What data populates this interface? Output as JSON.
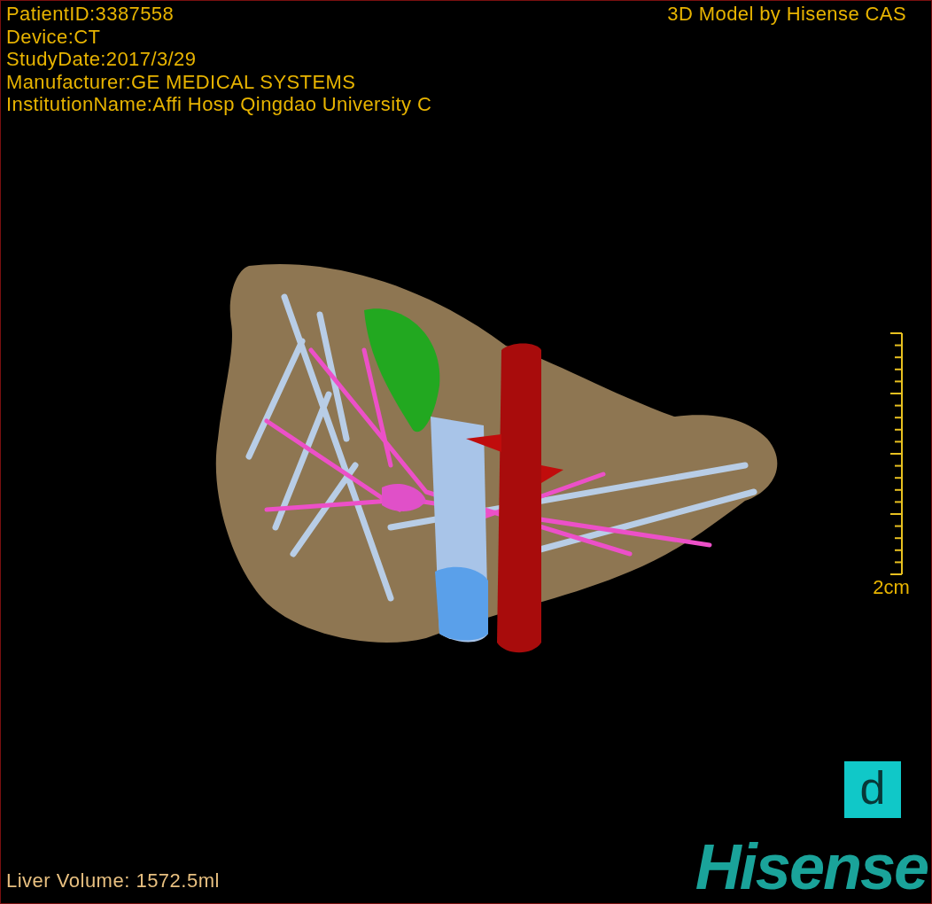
{
  "info_lines": [
    "PatientID:3387558",
    "Device:CT",
    "StudyDate:2017/3/29",
    "Manufacturer:GE MEDICAL SYSTEMS",
    "InstitutionName:Affi Hosp Qingdao University C"
  ],
  "title": "3D Model by Hisense CAS",
  "scale_bar": {
    "label": "2cm"
  },
  "volume": "Liver Volume: 1572.5ml",
  "badge": "d",
  "logo": "Hisense"
}
